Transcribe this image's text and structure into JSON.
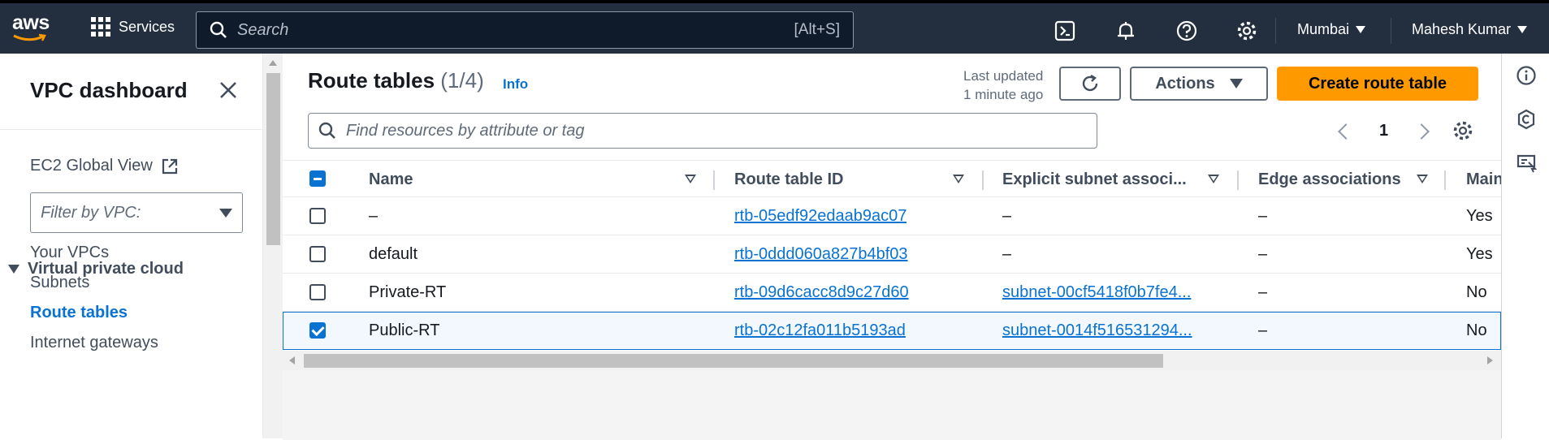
{
  "topnav": {
    "logo": "aws",
    "services_label": "Services",
    "search_placeholder": "Search",
    "search_shortcut": "[Alt+S]",
    "region": "Mumbai",
    "user": "Mahesh Kumar",
    "icons": [
      "cloudshell-icon",
      "notifications-icon",
      "help-icon",
      "settings-icon"
    ]
  },
  "sidebar": {
    "title": "VPC dashboard",
    "global_view": "EC2 Global View",
    "filter_placeholder": "Filter by VPC:",
    "section": "Virtual private cloud",
    "items": [
      {
        "label": "Your VPCs"
      },
      {
        "label": "Subnets"
      },
      {
        "label": "Route tables",
        "active": true
      },
      {
        "label": "Internet gateways"
      }
    ]
  },
  "main": {
    "title": "Route tables",
    "count": "(1/4)",
    "info": "Info",
    "last_updated": "Last updated",
    "updated_ago": "1 minute ago",
    "actions_label": "Actions",
    "create_label": "Create route table",
    "filter_placeholder": "Find resources by attribute or tag",
    "page": "1",
    "columns": [
      "Name",
      "Route table ID",
      "Explicit subnet associ...",
      "Edge associations",
      "Main"
    ],
    "rows": [
      {
        "name": "–",
        "id": "rtb-05edf92edaab9ac07",
        "subnet": "–",
        "edge": "–",
        "main": "Yes",
        "selected": false
      },
      {
        "name": "default",
        "id": "rtb-0ddd060a827b4bf03",
        "subnet": "–",
        "edge": "–",
        "main": "Yes",
        "selected": false
      },
      {
        "name": "Private-RT",
        "id": "rtb-09d6cacc8d9c27d60",
        "subnet": "subnet-00cf5418f0b7fe4...",
        "edge": "–",
        "main": "No",
        "selected": false
      },
      {
        "name": "Public-RT",
        "id": "rtb-02c12fa011b5193ad",
        "subnet": "subnet-0014f516531294...",
        "edge": "–",
        "main": "No",
        "selected": true
      }
    ]
  },
  "colors": {
    "nav_bg": "#232f3e",
    "link": "#0972d3",
    "primary": "#ff9900"
  }
}
